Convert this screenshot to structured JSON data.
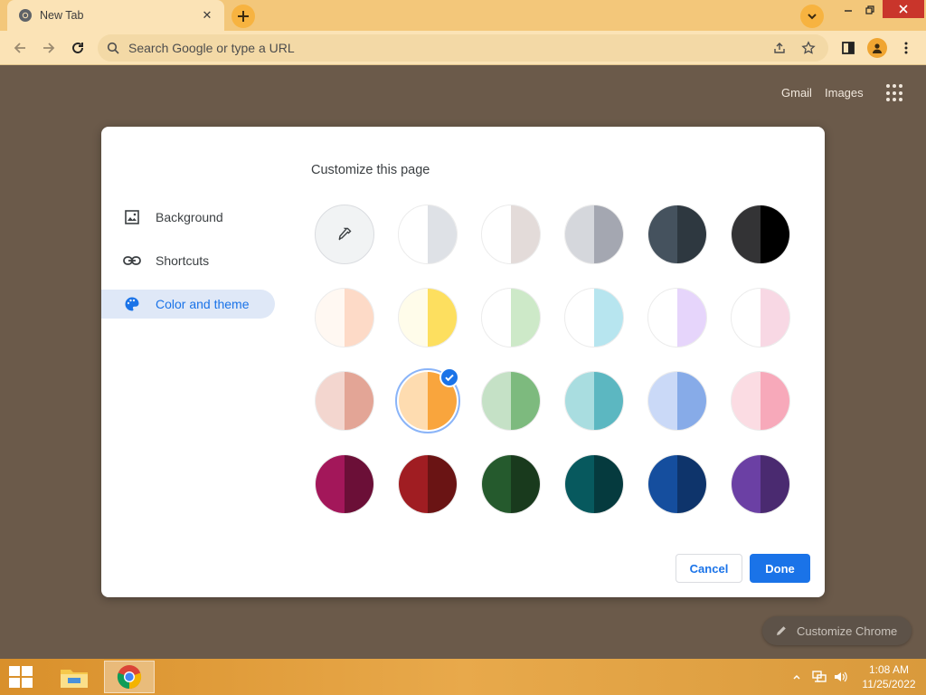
{
  "browser": {
    "tab": {
      "title": "New Tab"
    },
    "omnibox": {
      "placeholder": "Search Google or type a URL"
    }
  },
  "ntp": {
    "links": [
      "Gmail",
      "Images"
    ],
    "customize_chrome_label": "Customize Chrome"
  },
  "dialog": {
    "title": "Customize this page",
    "menu": [
      {
        "label": "Background",
        "icon": "image-icon",
        "active": false
      },
      {
        "label": "Shortcuts",
        "icon": "link-icon",
        "active": false
      },
      {
        "label": "Color and theme",
        "icon": "palette-icon",
        "active": true
      }
    ],
    "swatches": [
      {
        "kind": "custom",
        "icon": "eyedropper-icon"
      },
      {
        "left": "#ffffff",
        "right": "#dee1e6"
      },
      {
        "left": "#ffffff",
        "right": "#e3dbd9"
      },
      {
        "left": "#d5d7dc",
        "right": "#a4a7b1"
      },
      {
        "left": "#45525e",
        "right": "#2e3840"
      },
      {
        "left": "#333335",
        "right": "#000000"
      },
      {
        "left": "#fff8f2",
        "right": "#fddac7"
      },
      {
        "left": "#fffcea",
        "right": "#fddf5f"
      },
      {
        "left": "#ffffff",
        "right": "#cde9c8"
      },
      {
        "left": "#ffffff",
        "right": "#b7e5ef"
      },
      {
        "left": "#ffffff",
        "right": "#e6d5fb"
      },
      {
        "left": "#ffffff",
        "right": "#f8d8e4"
      },
      {
        "left": "#f3d6cf",
        "right": "#e3a596"
      },
      {
        "left": "#fedcb0",
        "right": "#f9a53d",
        "selected": true
      },
      {
        "left": "#c5e1c6",
        "right": "#7dba7e"
      },
      {
        "left": "#a9dde0",
        "right": "#5cb7c1"
      },
      {
        "left": "#cad9f7",
        "right": "#87abe8"
      },
      {
        "left": "#fbdce3",
        "right": "#f7a9ba"
      },
      {
        "left": "#a3175a",
        "right": "#6b0f37"
      },
      {
        "left": "#a01d22",
        "right": "#6a1414"
      },
      {
        "left": "#255a2d",
        "right": "#193a1d"
      },
      {
        "left": "#07595e",
        "right": "#053a3e"
      },
      {
        "left": "#154e9e",
        "right": "#0e346b"
      },
      {
        "left": "#6b40a4",
        "right": "#4a2a70"
      }
    ],
    "cancel_label": "Cancel",
    "done_label": "Done"
  },
  "taskbar": {
    "time": "1:08 AM",
    "date": "11/25/2022"
  },
  "colors": {
    "accent": "#1a73e8",
    "frame": "#f3c77a",
    "toolbar": "#fbe3b6",
    "ntp_background": "#6b5a4a"
  }
}
